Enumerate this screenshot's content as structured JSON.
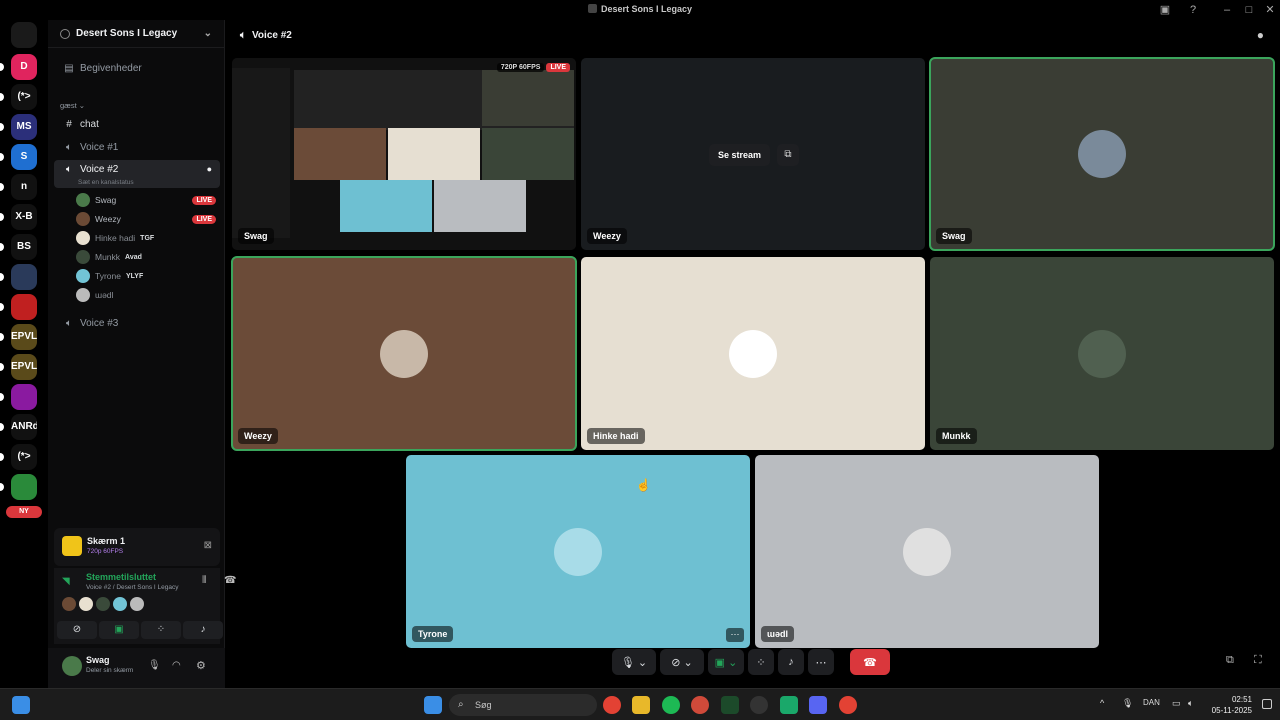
{
  "window": {
    "title": "Desert Sons I Legacy"
  },
  "servers": {
    "items": [
      {
        "label": "D",
        "color": "#e0245e"
      },
      {
        "label": "(*>",
        "color": "#111"
      },
      {
        "label": "MS",
        "color": "#2b2f7a"
      },
      {
        "label": "S",
        "color": "#1f6fd1"
      },
      {
        "label": "n",
        "color": "#111"
      },
      {
        "label": "X-B",
        "color": "#111"
      },
      {
        "label": "BS",
        "color": "#111"
      },
      {
        "label": "",
        "color": "#2a3a5a"
      },
      {
        "label": "",
        "color": "#c02020"
      },
      {
        "label": "EPVL",
        "color": "#5a4a1a"
      },
      {
        "label": "EPVL",
        "color": "#5a4a1a"
      },
      {
        "label": "",
        "color": "#8a1aa0"
      },
      {
        "label": "ANRdc",
        "color": "#111"
      },
      {
        "label": "(*>",
        "color": "#111"
      },
      {
        "label": "",
        "color": "#2a8a3a"
      }
    ],
    "new_badge": "NY"
  },
  "sidebar": {
    "guild_name": "Desert Sons I Legacy",
    "events": "Begivenheder",
    "category": "gæst",
    "channels": {
      "chat": "chat",
      "voice1": "Voice #1",
      "voice2": "Voice #2",
      "voice2_status": "Sæt en kanalstatus",
      "voice3": "Voice #3"
    },
    "voice_users": [
      {
        "name": "Swag",
        "live": "LIVE",
        "tag": "",
        "color": "#4a7a4a"
      },
      {
        "name": "Weezy",
        "live": "LIVE",
        "tag": "",
        "color": "#6b4a35"
      },
      {
        "name": "Hinke hadi",
        "live": "",
        "tag": "TGF",
        "color": "#e8e0d0"
      },
      {
        "name": "Munkk",
        "live": "",
        "tag": "Avad",
        "color": "#3a4a3a"
      },
      {
        "name": "Tyrone",
        "live": "",
        "tag": "YLYF",
        "color": "#72c4d6"
      },
      {
        "name": "ɯədl",
        "live": "",
        "tag": "",
        "color": "#bbb"
      }
    ]
  },
  "screen_share": {
    "title": "Skærm 1",
    "quality": "720p 60FPS"
  },
  "voice_status": {
    "title": "Stemmetilsluttet",
    "location": "Voice #2 / Desert Sons I Legacy"
  },
  "user": {
    "name": "Swag",
    "status": "Deler sin skærm"
  },
  "main": {
    "channel": "Voice #2",
    "stream_badge": "720P 60FPS",
    "live_badge": "LIVE",
    "watch_stream": "Se stream",
    "tiles": [
      {
        "name": "Swag",
        "color": "#0c0c0c"
      },
      {
        "name": "Weezy",
        "color": "#121416"
      },
      {
        "name": "Swag",
        "color": "#3a3d34"
      },
      {
        "name": "Weezy",
        "color": "#6b4b38"
      },
      {
        "name": "Hinke hadi",
        "color": "#e6dfd2"
      },
      {
        "name": "Munkk",
        "color": "#3a4538"
      },
      {
        "name": "Tyrone",
        "color": "#6ec0d2"
      },
      {
        "name": "ɯədl",
        "color": "#b9bcc0"
      }
    ]
  },
  "taskbar": {
    "search": "Søg",
    "language": "DAN",
    "time": "02:51",
    "date": "05-11-2025"
  },
  "colors": {
    "speaking": "#3ba55c",
    "live": "#da373c",
    "connected": "#23a55a"
  }
}
